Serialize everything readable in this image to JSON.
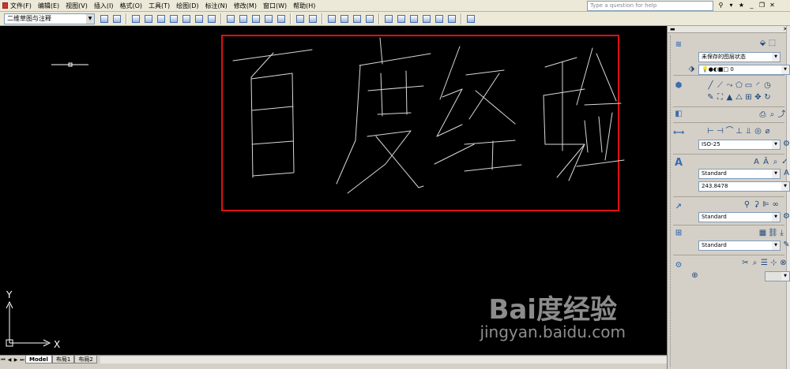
{
  "menus": [
    "文件(F)",
    "编辑(E)",
    "视图(V)",
    "插入(I)",
    "格式(O)",
    "工具(T)",
    "绘图(D)",
    "标注(N)",
    "修改(M)",
    "窗口(W)",
    "帮助(H)"
  ],
  "help_placeholder": "Type a question for help",
  "workspace": "二维草图与注释",
  "drawing_text": "百度经验",
  "ucs": {
    "y_label": "Y",
    "x_label": "X"
  },
  "layout_tabs": [
    "Model",
    "布局1",
    "布局2"
  ],
  "panel": {
    "layer_state": "未保存的图层状态",
    "layer_value": "0",
    "dim_style": "ISO-25",
    "text_style": "Standard",
    "text_height": "243.8478",
    "multileader_style": "Standard",
    "table_style": "Standard"
  },
  "watermark": {
    "brand": "Bai度经验",
    "url": "jingyan.baidu.com"
  },
  "colors": {
    "canvas": "#000000",
    "highlight": "#e01010",
    "stroke": "#d8d8d8"
  }
}
